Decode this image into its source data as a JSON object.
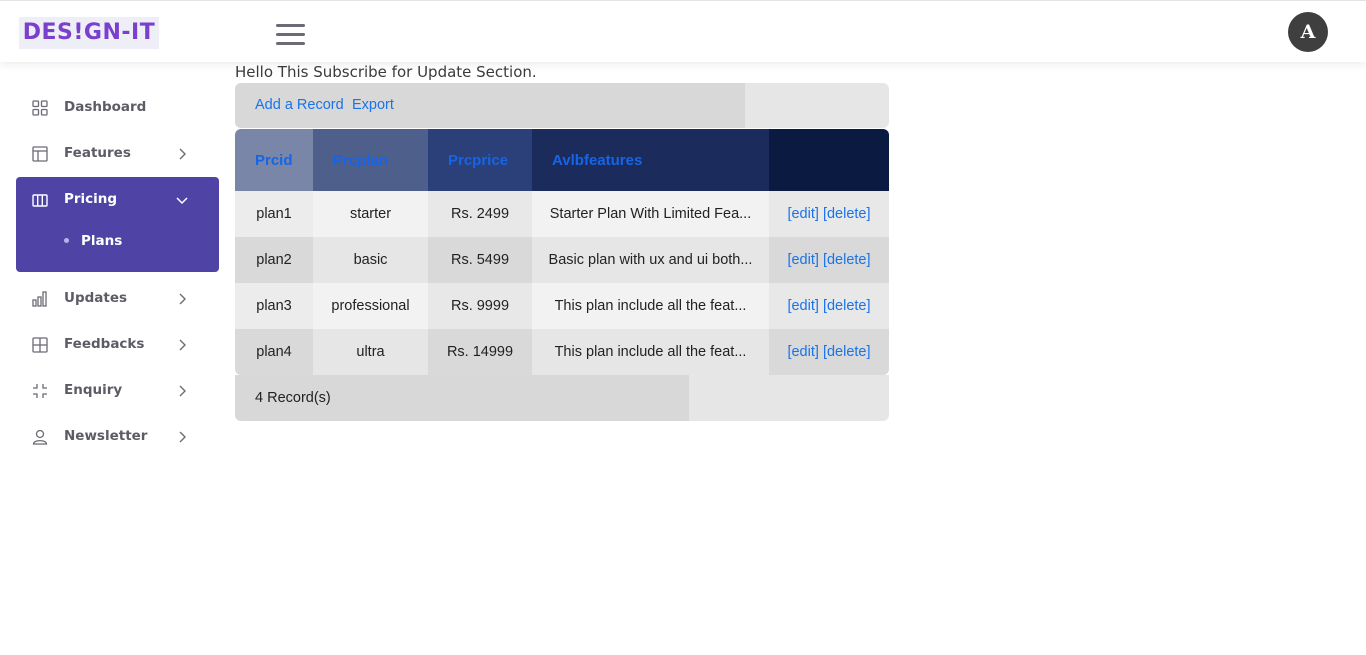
{
  "header": {
    "logo_text": "DES!GN-IT",
    "avatar_letter": "A"
  },
  "sidebar": {
    "items": [
      {
        "label": "Dashboard",
        "icon": "grid-icon"
      },
      {
        "label": "Features",
        "icon": "layout-icon"
      },
      {
        "label": "Pricing",
        "icon": "columns-icon",
        "active": true,
        "sub": [
          {
            "label": "Plans"
          }
        ]
      },
      {
        "label": "Updates",
        "icon": "bar-chart-icon"
      },
      {
        "label": "Feedbacks",
        "icon": "table-icon"
      },
      {
        "label": "Enquiry",
        "icon": "minimize-icon"
      },
      {
        "label": "Newsletter",
        "icon": "user-icon"
      }
    ]
  },
  "main": {
    "greeting": "Hello This Subscribe for Update Section.",
    "toolbar": {
      "add_label": "Add a Record",
      "export_label": "Export"
    },
    "table": {
      "columns": [
        "Prcid",
        "Prcplan",
        "Prcprice",
        "Avlbfeatures",
        ""
      ],
      "rows": [
        {
          "id": "plan1",
          "plan": "starter",
          "price": "Rs. 2499",
          "features": "Starter Plan With Limited Fea...",
          "edit": "[edit]",
          "delete": "[delete]"
        },
        {
          "id": "plan2",
          "plan": "basic",
          "price": "Rs. 5499",
          "features": "Basic plan with ux and ui both...",
          "edit": "[edit]",
          "delete": "[delete]"
        },
        {
          "id": "plan3",
          "plan": "professional",
          "price": "Rs. 9999",
          "features": "This plan include all the feat...",
          "edit": "[edit]",
          "delete": "[delete]"
        },
        {
          "id": "plan4",
          "plan": "ultra",
          "price": "Rs. 14999",
          "features": "This plan include all the feat...",
          "edit": "[edit]",
          "delete": "[delete]"
        }
      ]
    },
    "footer": {
      "record_count": "4 Record(s)"
    }
  },
  "colors": {
    "accent": "#4f44a6",
    "logo": "#7b3fce",
    "link": "#1a73e8",
    "header_cols": [
      "#7a86a8",
      "#4e5f8c",
      "#2b3f78",
      "#1b2b5c",
      "#0b1a40"
    ]
  }
}
